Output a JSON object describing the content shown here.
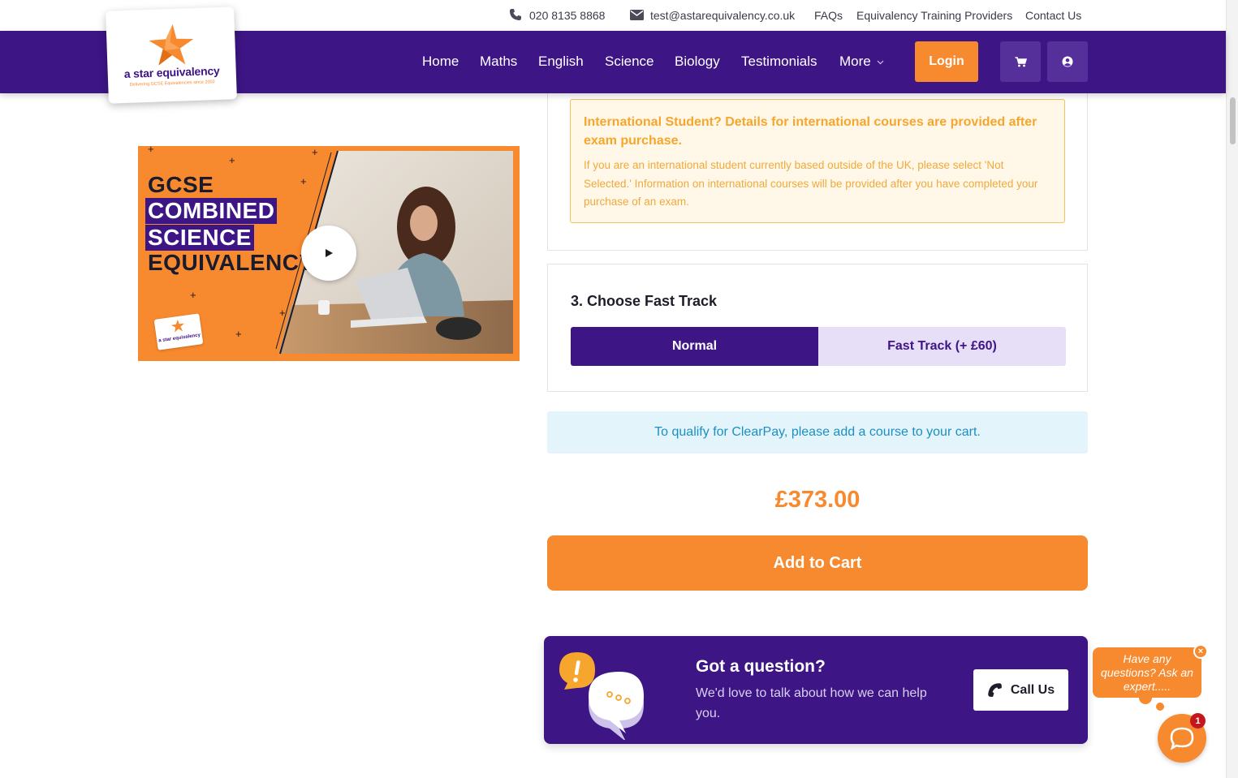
{
  "topbar": {
    "phone": "020 8135 8868",
    "email": "test@astarequivalency.co.uk",
    "links": [
      "FAQs",
      "Equivalency Training Providers",
      "Contact Us"
    ],
    "icons": [
      "phone-icon",
      "envelope-icon"
    ]
  },
  "logo": {
    "name": "a star equivalency",
    "tagline": "Delivering GCSE Equivalencies since 2002"
  },
  "nav": {
    "items": [
      "Home",
      "Maths",
      "English",
      "Science",
      "Biology",
      "Testimonials",
      "More"
    ],
    "login": "Login",
    "icons": [
      "cart-icon",
      "user-icon",
      "chevron-down-icon"
    ]
  },
  "video": {
    "line1": "GCSE",
    "line2": "COMBINED",
    "line3": "SCIENCE",
    "line4": "EQUIVALENCY",
    "logo_text": "a star equivalency"
  },
  "international": {
    "title": "International Student? Details for international courses are provided after exam purchase.",
    "text": "If you are an international student currently based outside of the UK, please select 'Not Selected.' Information on international courses will be provided after you have completed your purchase of an exam."
  },
  "fast_track": {
    "heading": "3. Choose Fast Track",
    "options": [
      "Normal",
      "Fast Track (+ £60)"
    ],
    "selected": "Normal"
  },
  "clearpay_note": "To qualify for ClearPay, please add a course to your cart.",
  "price": "£373.00",
  "add_to_cart": "Add to Cart",
  "question": {
    "title": "Got a question?",
    "text": "We'd love to talk about how we can help you.",
    "call_button": "Call Us"
  },
  "chat": {
    "prompt": "Have any questions? Ask an expert.....",
    "badge": "1",
    "close": "×"
  },
  "colors": {
    "brand_purple": "#3d1585",
    "brand_orange": "#f7892e",
    "fast_track_light": "#e7dff7",
    "clearpay_bg": "#e4f4fb",
    "notice_bg": "#fff8e9"
  }
}
